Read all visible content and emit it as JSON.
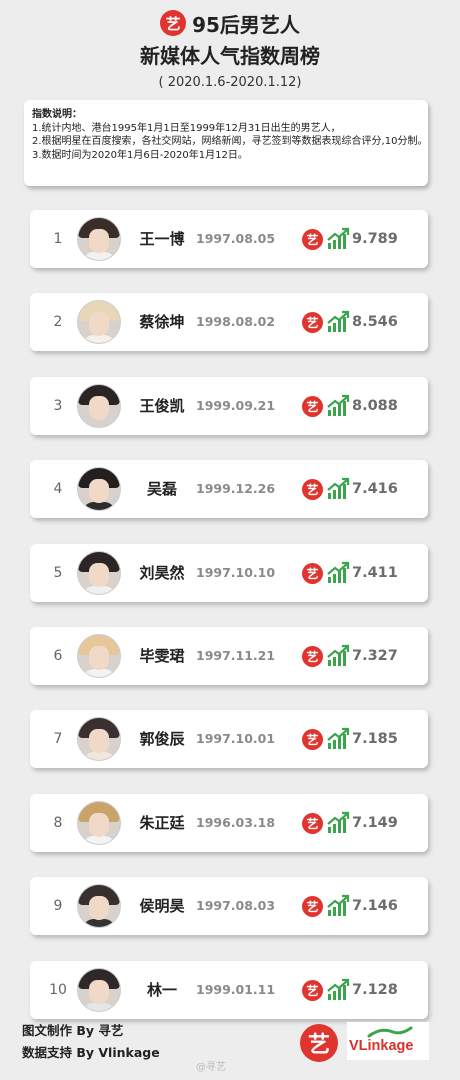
{
  "header": {
    "logo_char": "艺",
    "title_line1": "95后男艺人",
    "title_line2": "新媒体人气指数周榜",
    "date_range": "( 2020.1.6-2020.1.12)"
  },
  "notes": {
    "heading": "指数说明：",
    "line1": "1.统计内地、港台1995年1月1日至1999年12月31日出生的男艺人，",
    "line2": "2.根据明星在百度搜索，各社交网站，网络新闻，寻艺签到等数据表现综合评分,10分制。",
    "line3": "3.数据时间为2020年1月6日-2020年1月12日。"
  },
  "ranking": [
    {
      "rank": "1",
      "name": "王一博",
      "birth": "1997.08.05",
      "score": "9.789"
    },
    {
      "rank": "2",
      "name": "蔡徐坤",
      "birth": "1998.08.02",
      "score": "8.546"
    },
    {
      "rank": "3",
      "name": "王俊凯",
      "birth": "1999.09.21",
      "score": "8.088"
    },
    {
      "rank": "4",
      "name": "吴磊",
      "birth": "1999.12.26",
      "score": "7.416"
    },
    {
      "rank": "5",
      "name": "刘昊然",
      "birth": "1997.10.10",
      "score": "7.411"
    },
    {
      "rank": "6",
      "name": "毕雯珺",
      "birth": "1997.11.21",
      "score": "7.327"
    },
    {
      "rank": "7",
      "name": "郭俊辰",
      "birth": "1997.10.01",
      "score": "7.185"
    },
    {
      "rank": "8",
      "name": "朱正廷",
      "birth": "1996.03.18",
      "score": "7.149"
    },
    {
      "rank": "9",
      "name": "侯明昊",
      "birth": "1997.08.03",
      "score": "7.146"
    },
    {
      "rank": "10",
      "name": "林一",
      "birth": "1999.01.11",
      "score": "7.128"
    }
  ],
  "card_logo_char": "艺",
  "footer": {
    "made_by": "图文制作 By 寻艺",
    "data_by": "数据支持 By Vlinkage",
    "logo_char": "艺",
    "vlinkage_logo": "VLinkage",
    "watermark": "@寻艺"
  },
  "colors": {
    "brand_red": "#e0342f",
    "trend_green": "#3aa54a"
  }
}
